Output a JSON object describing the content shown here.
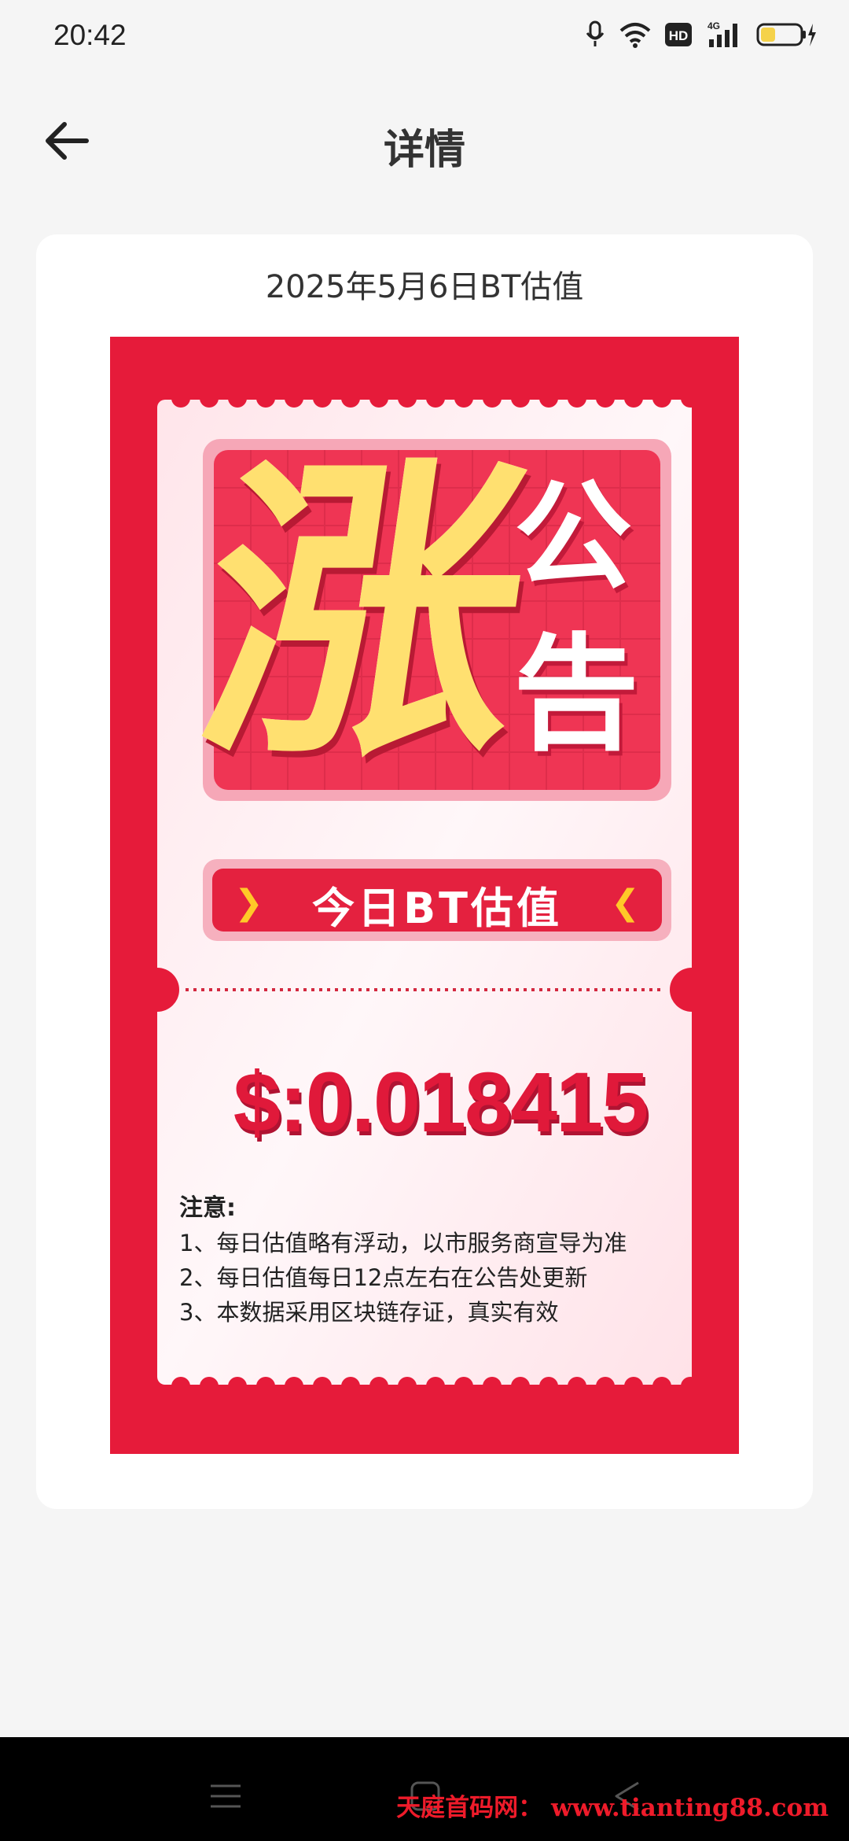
{
  "status_bar": {
    "time": "20:42",
    "network_badge": "4G",
    "hd_label": "HD"
  },
  "nav": {
    "title": "详情",
    "back_icon": "arrow-left-icon"
  },
  "card": {
    "title": "2025年5月6日BT估值"
  },
  "poster": {
    "headline_big": "涨",
    "headline_small": [
      "公",
      "告"
    ],
    "subtitle": "今日BT估值",
    "price": "$:0.018415",
    "notes_title": "注意:",
    "notes": [
      "1、每日估值略有浮动，以市服务商宣导为准",
      "2、每日估值每日12点左右在公告处更新",
      "3、本数据采用区块链存证，真实有效"
    ],
    "colors": {
      "red": "#e61b3a",
      "gold": "#ffe070",
      "arrow": "#ffc928"
    }
  },
  "system_nav": {
    "icons": [
      "menu-icon",
      "home-icon",
      "back-triangle-icon"
    ]
  },
  "watermark": "天庭首码网： www.tianting88.com"
}
